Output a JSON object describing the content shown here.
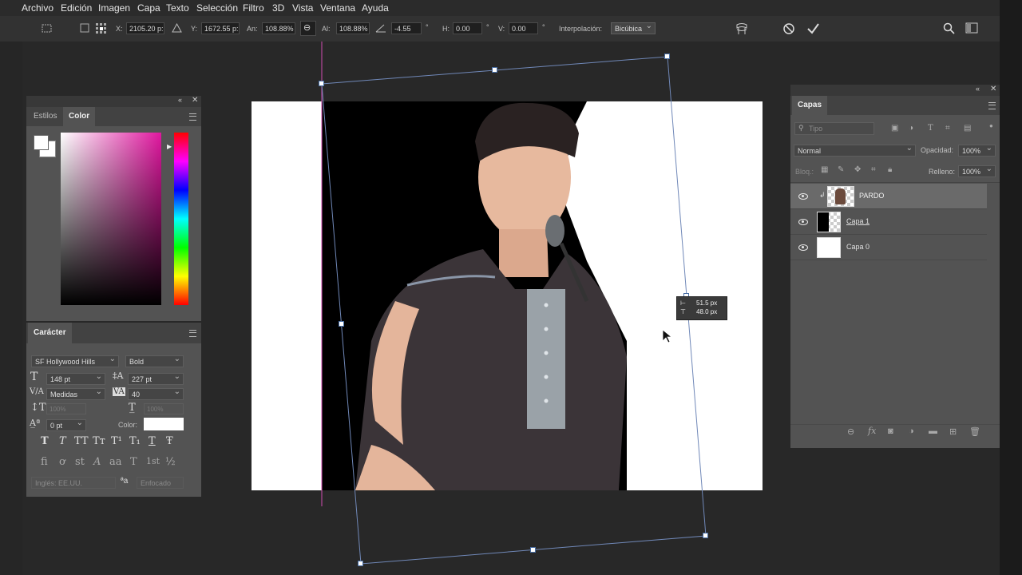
{
  "menu": [
    "Archivo",
    "Edición",
    "Imagen",
    "Capa",
    "Texto",
    "Selección",
    "Filtro",
    "3D",
    "Vista",
    "Ventana",
    "Ayuda"
  ],
  "options": {
    "x_label": "X:",
    "x_value": "2105.20 p:",
    "y_label": "Y:",
    "y_value": "1672.55 p:",
    "w_label": "An:",
    "w_value": "108.88%",
    "h_label": "Al:",
    "h_value": "108.88%",
    "angle_value": "-4.55",
    "angle_unit": "°",
    "hskew_label": "H:",
    "hskew_value": "0.00",
    "vskew_label": "V:",
    "vskew_value": "0.00",
    "interp_label": "Interpolación:",
    "interp_value": "Bicúbica"
  },
  "left_panel": {
    "tab_styles": "Estilos",
    "tab_color": "Color",
    "char_tab": "Carácter",
    "font_family": "SF Hollywood Hills",
    "font_style": "Bold",
    "font_size": "148 pt",
    "leading": "227 pt",
    "kerning": "Medidas",
    "tracking": "40",
    "vscale": "100%",
    "hscale": "100%",
    "baseline": "0 pt",
    "color_label": "Color:",
    "language": "Inglés: EE.UU.",
    "aa_label": "ªa",
    "antialias": "Enfocado",
    "style_glyphs": [
      "T",
      "T",
      "TT",
      "Tт",
      "T¹",
      "T₁",
      "T",
      "Ŧ"
    ],
    "ot_glyphs": [
      "ﬁ",
      "ơ",
      "st",
      "A",
      "aa",
      "T",
      "1st",
      "½"
    ]
  },
  "layers_panel": {
    "tab": "Capas",
    "filter_placeholder": "Tipo",
    "blend_mode": "Normal",
    "opacity_label": "Opacidad:",
    "opacity_value": "100%",
    "lock_label": "Bloq.:",
    "fill_label": "Relleno:",
    "fill_value": "100%",
    "layers": [
      {
        "name": "PARDO"
      },
      {
        "name": "Capa 1"
      },
      {
        "name": "Capa 0"
      }
    ]
  },
  "transform_tooltip": {
    "line1": "51.5 px",
    "line2": "48.0 px"
  }
}
